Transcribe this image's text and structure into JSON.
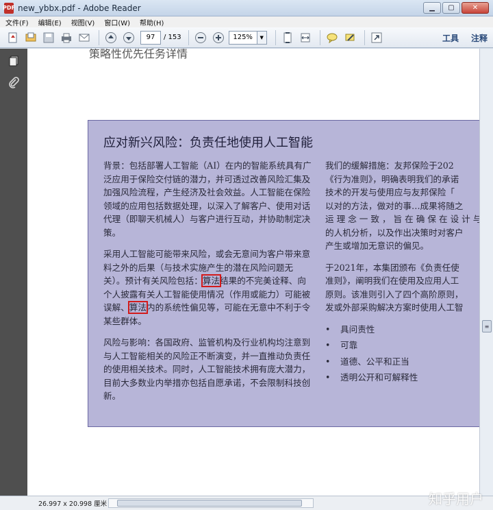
{
  "window": {
    "title": "new_ybbx.pdf - Adobe Reader",
    "app_icon_label": "PDF"
  },
  "menu": [
    "文件(F)",
    "编辑(E)",
    "视图(V)",
    "窗口(W)",
    "帮助(H)"
  ],
  "toolbar": {
    "page_current": "97",
    "page_total": "/ 153",
    "zoom": "125%",
    "tools_label": "工具",
    "comment_label": "注释"
  },
  "document": {
    "top_heading": "策略性优先任务详情",
    "panel_title": "应对新兴风险：负责任地使用人工智能",
    "left": {
      "p1": "背景：包括部署人工智能（AI）在内的智能系统具有广泛应用于保险交付链的潜力，并可透过改善风险汇集及加强风险流程，产生经济及社会效益。人工智能在保险领域的应用包括数据处理，以深入了解客户、使用对话代理（即聊天机械人）与客户进行互动，并协助制定决策。",
      "p2_a": "采用人工智能可能带来风险，或会无意间为客户带来意料之外的后果（与技术实施产生的潜在风险问题无关）。预计有关风险包括：",
      "p2_hl1": "算法",
      "p2_b": "结果的不完美诠释、向个人披露有关人工智能使用情况（作用或能力）可能被误解、",
      "p2_hl2": "算法",
      "p2_c": "内的系统性偏见等，可能在无意中不利于令某些群体。",
      "p3": "风险与影响：各国政府、监管机构及行业机构均注意到与人工智能相关的风险正不断演变，并一直推动负责任的使用相关技术。同时，人工智能技术拥有庞大潜力，目前大多数业内举措亦包括自愿承诺，不会限制科技创新。"
    },
    "right": {
      "lines_a": [
        "我们的缓解措施：友邦保险于202",
        "《行为准则》，明确表明我们的承诺",
        "技术的开发与使用应与友邦保险「",
        "以对的方法，做对的事…成果将随之",
        "运 理 念 一 致 ， 旨 在 确 保 在 设 计 与",
        "的人机分析，以及作出决策时对客户",
        "产生或增加无意识的偏见。"
      ],
      "lines_b": [
        "于2021年，本集团颁布《负责任使",
        "准则》，阐明我们在使用及应用人工",
        "原则。该准则引入了四个高阶原则，",
        "发或外部采购解决方案时使用人工智"
      ],
      "bullets": [
        "具问责性",
        "可靠",
        "道德、公平和正当",
        "透明公开和可解释性"
      ]
    }
  },
  "status": {
    "page_size": "26.997 x 20.998 厘米",
    "watermark": "知乎用户"
  }
}
